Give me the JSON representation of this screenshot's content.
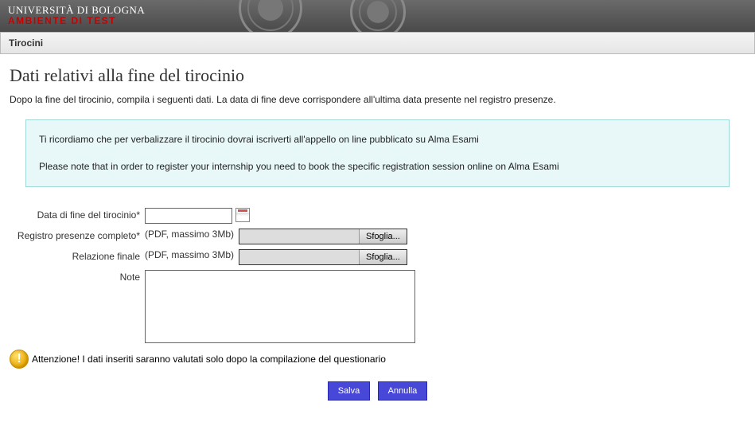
{
  "header": {
    "logo": "UNIVERSITÀ DI BOLOGNA",
    "env": "AMBIENTE DI TEST"
  },
  "nav": {
    "title": "Tirocini"
  },
  "page": {
    "title": "Dati relativi alla fine del tirocinio",
    "intro": "Dopo la fine del tirocinio, compila i seguenti dati. La data di fine deve corrispondere all'ultima data presente nel registro presenze."
  },
  "notice": {
    "line1": "Ti ricordiamo che per verbalizzare il tirocinio dovrai iscriverti all'appello on line pubblicato su Alma Esami",
    "line2": "Please note that in order to register your internship you need to book the specific registration session online on Alma Esami"
  },
  "form": {
    "date_label": "Data di fine del tirocinio*",
    "date_value": "",
    "register_label": "Registro presenze completo*",
    "report_label": "Relazione finale",
    "file_hint": "(PDF, massimo 3Mb)",
    "browse": "Sfoglia...",
    "notes_label": "Note",
    "notes_value": ""
  },
  "warning": {
    "text": "Attenzione! I dati inseriti saranno valutati solo dopo la compilazione del questionario"
  },
  "buttons": {
    "save": "Salva",
    "cancel": "Annulla"
  }
}
